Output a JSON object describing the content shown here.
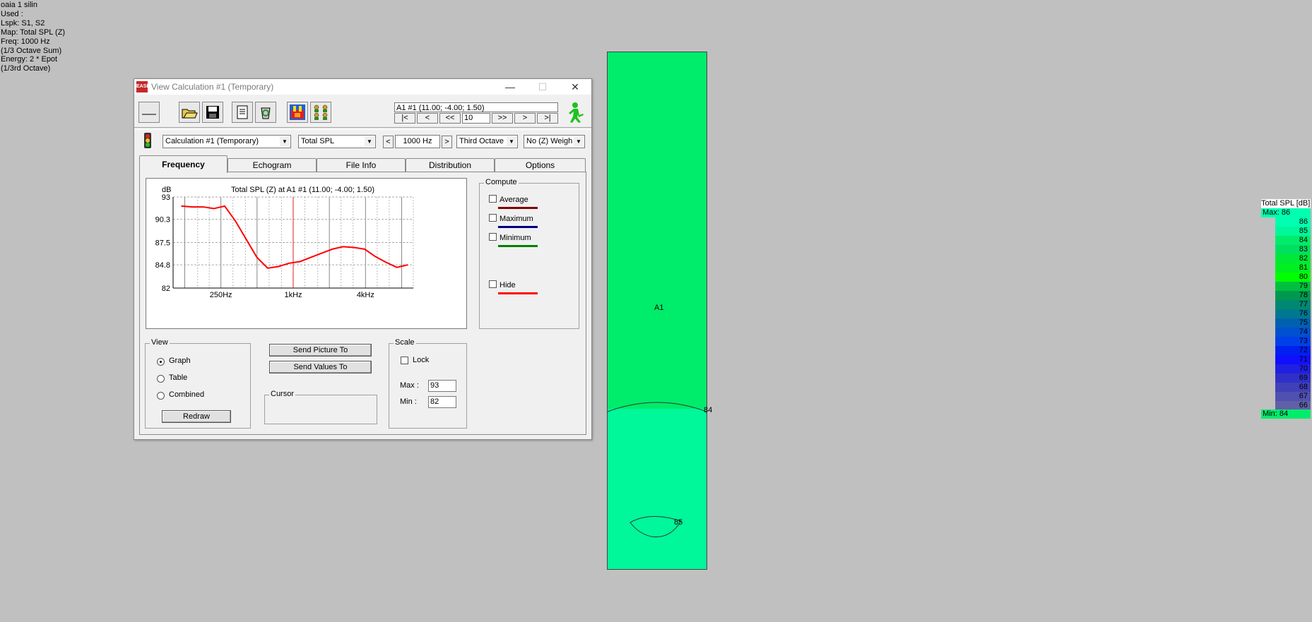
{
  "info_lines": [
    "oaia 1 silin",
    "Used :",
    "Lspk: S1, S2",
    "Map: Total SPL (Z)",
    "Freq: 1000 Hz",
    "(1/3 Octave Sum)",
    "Energy: 2 * Epot",
    "(1/3rd Octave)"
  ],
  "window": {
    "title": "View Calculation #1 (Temporary)",
    "minimize": "—",
    "maximize": "☐",
    "close": "✕"
  },
  "toolbar": {
    "position_text": "A1 #1  (11.00; -4.00; 1.50)",
    "nav": [
      "|<",
      "<",
      "<<",
      ">>",
      ">",
      ">|"
    ],
    "step_value": "10"
  },
  "selectors": {
    "calculation": "Calculation #1 (Temporary)",
    "map_type": "Total SPL",
    "frequency": "1000 Hz",
    "bandwidth": "Third Octave",
    "weighting": "No (Z) Weigh"
  },
  "tabs": [
    "Frequency",
    "Echogram",
    "File Info",
    "Distribution",
    "Options"
  ],
  "compute": {
    "label": "Compute",
    "items": [
      {
        "label": "Average",
        "color": "#800000"
      },
      {
        "label": "Maximum",
        "color": "#000080"
      },
      {
        "label": "Minimum",
        "color": "#008000"
      },
      {
        "label": "Hide",
        "color": "#ff0000"
      }
    ]
  },
  "view_group": {
    "label": "View",
    "options": [
      "Graph",
      "Table",
      "Combined"
    ],
    "selected": 0,
    "redraw": "Redraw"
  },
  "buttons": {
    "send_picture": "Send Picture To",
    "send_values": "Send Values To"
  },
  "cursor_label": "Cursor",
  "scale": {
    "label": "Scale",
    "lock": "Lock",
    "max_label": "Max :",
    "max_value": "93",
    "min_label": "Min :",
    "min_value": "82"
  },
  "chart_data": {
    "type": "line",
    "title": "Total SPL (Z) at A1 #1  (11.00; -4.00; 1.50)",
    "ylabel": "dB",
    "ylim": [
      82,
      93
    ],
    "yticks": [
      "93",
      "90.3",
      "87.5",
      "84.8",
      "82"
    ],
    "xticks": [
      "250Hz",
      "1kHz",
      "4kHz"
    ],
    "xscale": "log",
    "x": [
      100,
      125,
      160,
      200,
      250,
      315,
      400,
      500,
      630,
      800,
      1000,
      1250,
      1600,
      2000,
      2500,
      3150,
      4000,
      5000,
      6300,
      8000,
      10000
    ],
    "series": [
      {
        "values": [
          91.9,
          91.8,
          91.8,
          91.6,
          91.9,
          90.1,
          87.9,
          85.7,
          84.4,
          84.6,
          85.0,
          85.2,
          85.7,
          86.2,
          86.7,
          87.0,
          86.9,
          86.7,
          85.8,
          85.1,
          84.5,
          84.8
        ],
        "color": "#ff0000"
      }
    ],
    "cursor_x": 1000,
    "grid": true
  },
  "map": {
    "receiver_label": "A1",
    "contour_84": "84",
    "contour_85": "85",
    "colors": {
      "upper": "#00ec6b",
      "lower": "#00f79a"
    }
  },
  "legend": {
    "title": "Total SPL [dB]",
    "max_text": "Max:  86",
    "min_text": "Min:  84",
    "levels": [
      {
        "v": "86",
        "c": "#00ffb0"
      },
      {
        "v": "85",
        "c": "#00f79a"
      },
      {
        "v": "84",
        "c": "#00ec6b"
      },
      {
        "v": "83",
        "c": "#00e060"
      },
      {
        "v": "82",
        "c": "#00e838"
      },
      {
        "v": "81",
        "c": "#00f020"
      },
      {
        "v": "80",
        "c": "#00ff00"
      },
      {
        "v": "79",
        "c": "#00c040"
      },
      {
        "v": "78",
        "c": "#009850"
      },
      {
        "v": "77",
        "c": "#008870"
      },
      {
        "v": "76",
        "c": "#007890"
      },
      {
        "v": "75",
        "c": "#0060b0"
      },
      {
        "v": "74",
        "c": "#0050d0"
      },
      {
        "v": "73",
        "c": "#0040e8"
      },
      {
        "v": "72",
        "c": "#0020f0"
      },
      {
        "v": "71",
        "c": "#1010ff"
      },
      {
        "v": "70",
        "c": "#2020e0"
      },
      {
        "v": "69",
        "c": "#3030c8"
      },
      {
        "v": "68",
        "c": "#4040b8"
      },
      {
        "v": "67",
        "c": "#5050b0"
      },
      {
        "v": "66",
        "c": "#6060a8"
      }
    ]
  }
}
